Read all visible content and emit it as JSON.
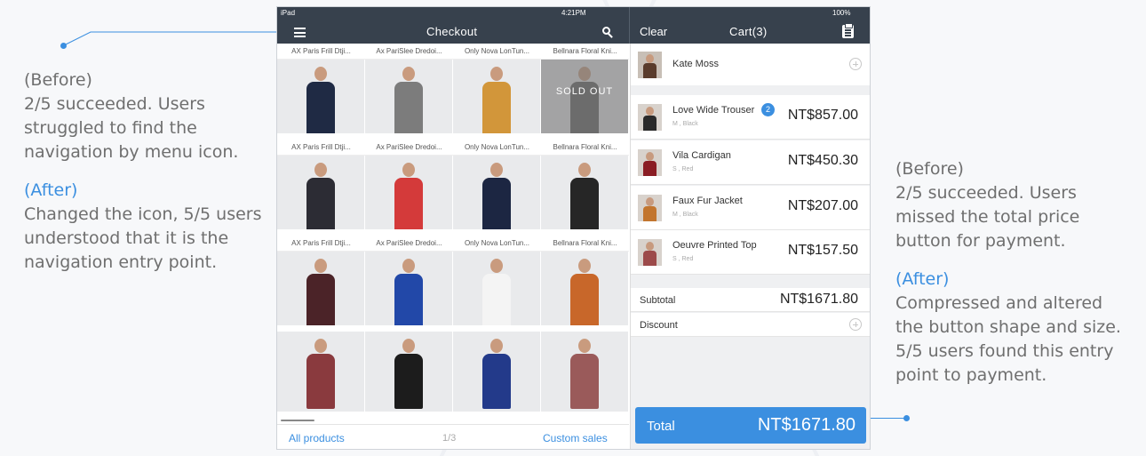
{
  "annotations": {
    "left": {
      "before_label": "(Before)",
      "before_lines": [
        "2/5 succeeded. Users",
        "struggled to find the",
        "navigation by menu icon."
      ],
      "after_label": "(After)",
      "after_lines": [
        "Changed the icon, 5/5 users",
        "understood that it is the",
        "navigation entry point."
      ]
    },
    "right": {
      "before_label": "(Before)",
      "before_lines": [
        "2/5 succeeded. Users",
        "missed the total price",
        "button for payment."
      ],
      "after_label": "(After)",
      "after_lines": [
        "Compressed and altered",
        "the button shape and size.",
        "5/5 users found this entry",
        "point to payment."
      ]
    },
    "accent_color": "#3b8fe0"
  },
  "statusbar": {
    "device": "iPad",
    "time": "4:21PM",
    "battery": "100%"
  },
  "navbar": {
    "menu_icon": "hamburger-menu-icon",
    "title": "Checkout",
    "search_icon": "search-icon",
    "clear_label": "Clear",
    "cart_title": "Cart(3)",
    "clipboard_icon": "clipboard-icon"
  },
  "products": {
    "columns": [
      "AX Paris Frill Dtji...",
      "Ax PariSlee Dredoi...",
      "Only Nova LonTun...",
      "Bellnara Floral Kni..."
    ],
    "rows": [
      {
        "names": [
          "AX Paris Frill Dtji...",
          "Ax PariSlee Dredoi...",
          "Only Nova LonTun...",
          "Bellnara Floral Kni..."
        ],
        "colors": [
          "#1f2a44",
          "#7c7c7c",
          "#d2963a",
          "#5b5b5b"
        ],
        "soldout": [
          false,
          false,
          false,
          true
        ]
      },
      {
        "names": [
          "AX Paris Frill Dtji...",
          "Ax PariSlee Dredoi...",
          "Only Nova LonTun...",
          "Bellnara Floral Kni..."
        ],
        "colors": [
          "#2c2c34",
          "#d43a3a",
          "#1c2642",
          "#262626"
        ],
        "soldout": [
          false,
          false,
          false,
          false
        ]
      },
      {
        "names": [
          "AX Paris Frill Dtji...",
          "Ax PariSlee Dredoi...",
          "Only Nova LonTun...",
          "Bellnara Floral Kni..."
        ],
        "colors": [
          "#4b2328",
          "#2248a8",
          "#f4f4f4",
          "#c8672a"
        ],
        "soldout": [
          false,
          false,
          false,
          false
        ]
      },
      {
        "names": [
          "",
          "",
          "",
          ""
        ],
        "colors": [
          "#8a3a3e",
          "#1c1c1c",
          "#233a8a",
          "#9a5a5a"
        ],
        "soldout": [
          false,
          false,
          false,
          false
        ]
      }
    ],
    "soldout_label": "SOLD OUT"
  },
  "footer": {
    "all_products": "All products",
    "pager": "1/3",
    "custom_sales": "Custom sales"
  },
  "cart": {
    "customer": {
      "name": "Kate Moss",
      "add_icon": "plus-circle-icon"
    },
    "items": [
      {
        "name": "Love Wide Trouser",
        "variant": "M , Black",
        "price": "NT$857.00",
        "qty": "2",
        "color": "#2a2a2a"
      },
      {
        "name": "Vila Cardigan",
        "variant": "S , Red",
        "price": "NT$450.30",
        "qty": "",
        "color": "#8a1d24"
      },
      {
        "name": "Faux Fur Jacket",
        "variant": "M , Black",
        "price": "NT$207.00",
        "qty": "",
        "color": "#c2752e"
      },
      {
        "name": "Oeuvre Printed Top",
        "variant": "S , Red",
        "price": "NT$157.50",
        "qty": "",
        "color": "#9c4a4a"
      }
    ],
    "subtotal_label": "Subtotal",
    "subtotal_value": "NT$1671.80",
    "discount_label": "Discount",
    "total_label": "Total",
    "total_value": "NT$1671.80"
  }
}
